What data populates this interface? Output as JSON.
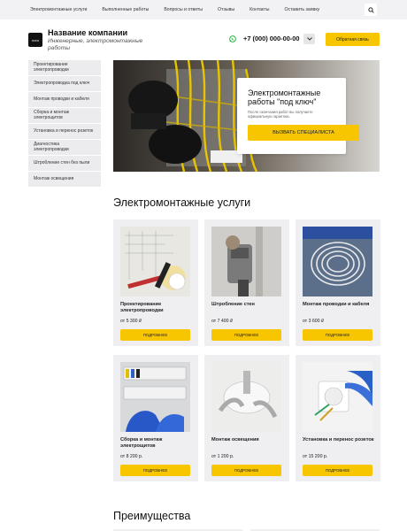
{
  "topnav": {
    "items": [
      "Электромонтажные услуги",
      "Выполненные работы",
      "Вопросы и ответы",
      "Отзывы",
      "Контакты",
      "Оставить заявку"
    ],
    "search_icon": "search-icon"
  },
  "header": {
    "logo_text": "лого",
    "company_name": "Название компании",
    "company_sub": "Инженерные, электромонтажные работы",
    "phone": "+7 (000) 000-00-00",
    "phone_icon": "whatsapp-icon",
    "callback_label": "Обратная связь"
  },
  "sidebar": {
    "items": [
      "Проектирование электропроводки",
      "Электропроводка под ключ",
      "Монтаж проводки и кабеля",
      "Сборка и монтаж электрощитов",
      "Установка и перенос розеток",
      "Диагностика электропроводки",
      "Штробление стен без пыли",
      "Монтаж освещения"
    ]
  },
  "hero": {
    "title": "Электромонтажные работы \"под ключ\"",
    "text": "После окончания работ вы получаете официальную гарантию.",
    "button": "ВЫЗВАТЬ СПЕЦИАЛИСТА"
  },
  "services": {
    "title": "Электромонтажные услуги",
    "more_label": "ПОДРОБНЕЕ",
    "cards": [
      {
        "title": "Проектирование электропроводки",
        "price": "от 5 300 ₽"
      },
      {
        "title": "Штробление стен",
        "price": "от 7 400 ₽"
      },
      {
        "title": "Монтаж проводки и кабеля",
        "price": "от 3 600 ₽"
      },
      {
        "title": "Сборка и монтаж электрощитов",
        "price": "от 8 200 р."
      },
      {
        "title": "Монтаж освещения",
        "price": "от 1 200 р."
      },
      {
        "title": "Установка и перенос розеток",
        "price": "от 15 200 р."
      }
    ]
  },
  "advantages": {
    "title": "Преимущества"
  },
  "colors": {
    "accent": "#f7c600",
    "panel": "#efeff2",
    "topbar": "#f2f2f4"
  }
}
